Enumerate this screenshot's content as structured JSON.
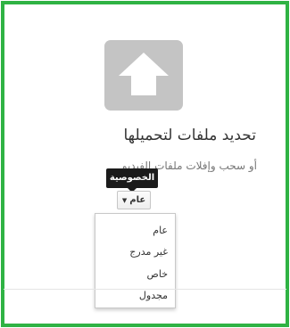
{
  "upload": {
    "icon": "upload-arrow-icon",
    "title": "تحديد ملفات لتحميلها",
    "subtitle": "أو سحب وإفلات ملفات الفيديو"
  },
  "privacy": {
    "tooltip": "الخصوصية",
    "selected": "عام",
    "options": [
      "عام",
      "غير مدرج",
      "خاص",
      "مجدول"
    ]
  },
  "colors": {
    "frame_border": "#2fb344",
    "icon_bg": "#c4c4c4",
    "tooltip_bg": "#1b1b1b"
  }
}
